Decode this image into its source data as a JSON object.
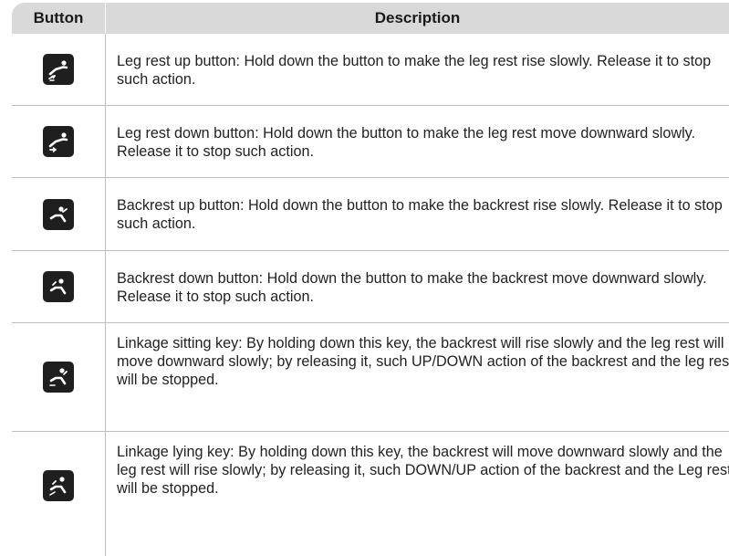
{
  "header": {
    "button": "Button",
    "description": "Description"
  },
  "rows": [
    {
      "icon": "leg-rest-up-icon",
      "text": "Leg rest up button: Hold down the button to make the leg rest rise slowly. Release it to stop such action."
    },
    {
      "icon": "leg-rest-down-icon",
      "text": "Leg rest down button: Hold down the button to make the leg rest move downward slowly. Release it to stop such action."
    },
    {
      "icon": "backrest-up-icon",
      "text": "Backrest up button: Hold down the button to make the backrest rise slowly. Release it to stop such action."
    },
    {
      "icon": "backrest-down-icon",
      "text": "Backrest down button: Hold down the button to make the backrest move downward slowly. Release it to stop such action."
    },
    {
      "icon": "linkage-sitting-icon",
      "text": "Linkage sitting key: By holding down this key, the backrest will rise slowly and the leg rest will move downward slowly; by releasing it, such UP/DOWN action of the backrest and the leg rest will be stopped."
    },
    {
      "icon": "linkage-lying-icon",
      "text": "Linkage lying key: By holding down this key, the backrest will move downward slowly and the leg rest will rise slowly; by releasing it, such DOWN/UP action of the backrest and the Leg rest will be stopped."
    }
  ]
}
